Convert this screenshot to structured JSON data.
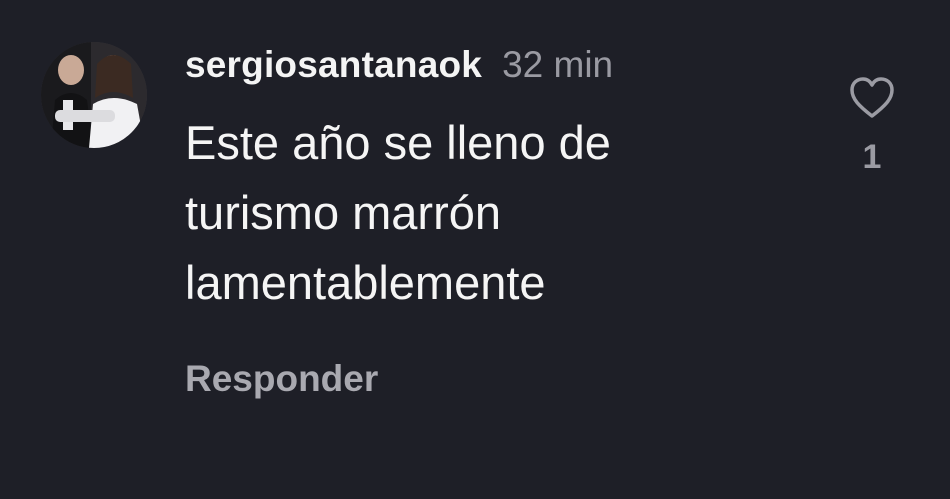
{
  "comment": {
    "username": "sergiosantanaok",
    "time": "32 min",
    "text": "Este año se lleno de turismo marrón lamentablemente",
    "reply_label": "Responder",
    "like_count": "1",
    "icons": {
      "avatar": "avatar",
      "like": "heart-outline-icon"
    }
  }
}
